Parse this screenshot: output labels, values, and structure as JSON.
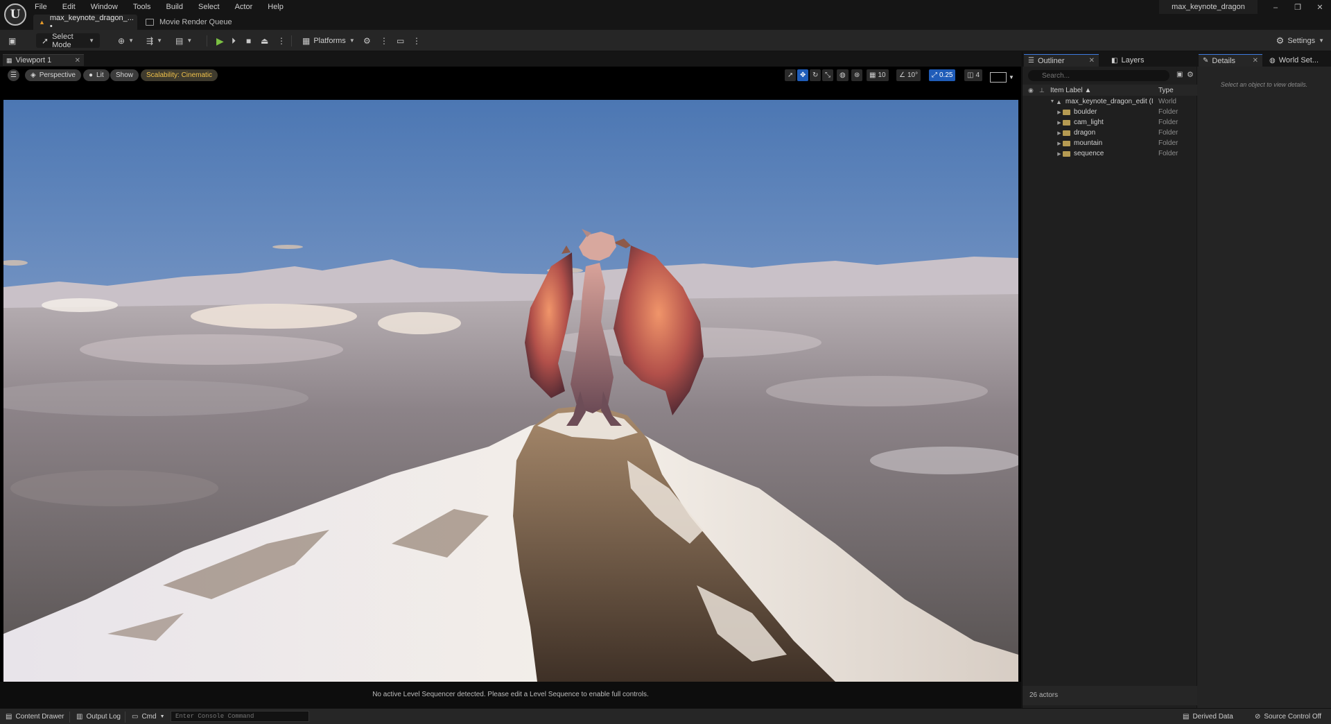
{
  "menu": [
    "File",
    "Edit",
    "Window",
    "Tools",
    "Build",
    "Select",
    "Actor",
    "Help"
  ],
  "logo": "U",
  "tabs": {
    "document": "max_keynote_dragon_... •",
    "movie_render_queue": "Movie Render Queue"
  },
  "project_name": "max_keynote_dragon",
  "window_controls": [
    "–",
    "❐",
    "✕"
  ],
  "toolbar": {
    "select_mode": "Select Mode",
    "platforms": "Platforms",
    "settings": "Settings"
  },
  "viewport": {
    "tab_label": "Viewport 1",
    "perspective": "Perspective",
    "lit": "Lit",
    "show": "Show",
    "scalability": "Scalability: Cinematic",
    "grid_size": "10",
    "rotation_snap": "10°",
    "scale_snap": "0.25",
    "camera_speed": "4",
    "status_message": "No active Level Sequencer detected. Please edit a Level Sequence to enable full controls."
  },
  "outliner": {
    "tab_label": "Outliner",
    "layers_tab": "Layers",
    "search_placeholder": "Search...",
    "col_label": "Item Label ▲",
    "col_type": "Type",
    "root": {
      "label": "max_keynote_dragon_edit (I",
      "type": "World"
    },
    "items": [
      {
        "label": "boulder",
        "type": "Folder"
      },
      {
        "label": "cam_light",
        "type": "Folder"
      },
      {
        "label": "dragon",
        "type": "Folder"
      },
      {
        "label": "mountain",
        "type": "Folder"
      },
      {
        "label": "sequence",
        "type": "Folder"
      }
    ],
    "footer": "26 actors"
  },
  "details": {
    "tab_label": "Details",
    "world_settings_tab": "World Set...",
    "empty_message": "Select an object to view details."
  },
  "bottombar": {
    "content_drawer": "Content Drawer",
    "output_log": "Output Log",
    "cmd": "Cmd",
    "console_placeholder": "Enter Console Command",
    "derived_data": "Derived Data",
    "source_control": "Source Control Off"
  }
}
